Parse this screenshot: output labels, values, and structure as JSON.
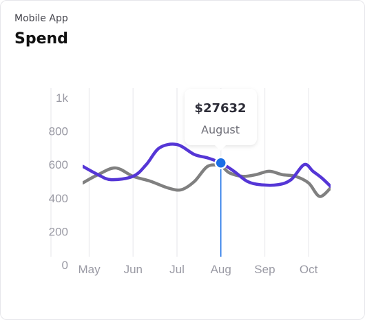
{
  "header": {
    "subtitle": "Mobile App",
    "title": "Spend"
  },
  "tooltip": {
    "value": "$27632",
    "month": "August"
  },
  "chart_data": {
    "type": "line",
    "title": "Spend",
    "xlabel": "",
    "ylabel": "",
    "ylim": [
      0,
      1000
    ],
    "yticks": [
      0,
      200,
      400,
      600,
      800,
      1000
    ],
    "ytick_labels": [
      "0",
      "200",
      "400",
      "600",
      "800",
      "1k"
    ],
    "xlim": [
      4.85,
      10.5
    ],
    "x_ticks": [
      5,
      6,
      7,
      8,
      9,
      10
    ],
    "x_tick_labels": [
      "May",
      "Jun",
      "Jul",
      "Aug",
      "Sep",
      "Oct"
    ],
    "grid": "vertical",
    "legend": "none",
    "highlight": {
      "x": 8,
      "y": 610
    },
    "colors": {
      "series_a": "#5536d6",
      "series_b": "#808080",
      "highlight": "#1a6fe6"
    },
    "series": [
      {
        "x": [
          4.85,
          5.2,
          5.5,
          6.0,
          6.3,
          6.6,
          7.0,
          7.4,
          7.7,
          8.0,
          8.3,
          8.6,
          8.9,
          9.3,
          9.6,
          9.9,
          10.1,
          10.3,
          10.5
        ],
        "values": [
          590,
          540,
          510,
          530,
          600,
          700,
          720,
          660,
          640,
          610,
          560,
          500,
          480,
          480,
          510,
          600,
          560,
          520,
          470
        ]
      },
      {
        "x": [
          4.85,
          5.2,
          5.6,
          6.0,
          6.4,
          6.8,
          7.1,
          7.4,
          7.7,
          8.0,
          8.2,
          8.5,
          8.8,
          9.1,
          9.4,
          9.7,
          10.0,
          10.25,
          10.5
        ],
        "values": [
          490,
          540,
          580,
          530,
          500,
          460,
          450,
          500,
          590,
          590,
          550,
          530,
          540,
          560,
          540,
          530,
          490,
          410,
          460
        ]
      }
    ]
  }
}
